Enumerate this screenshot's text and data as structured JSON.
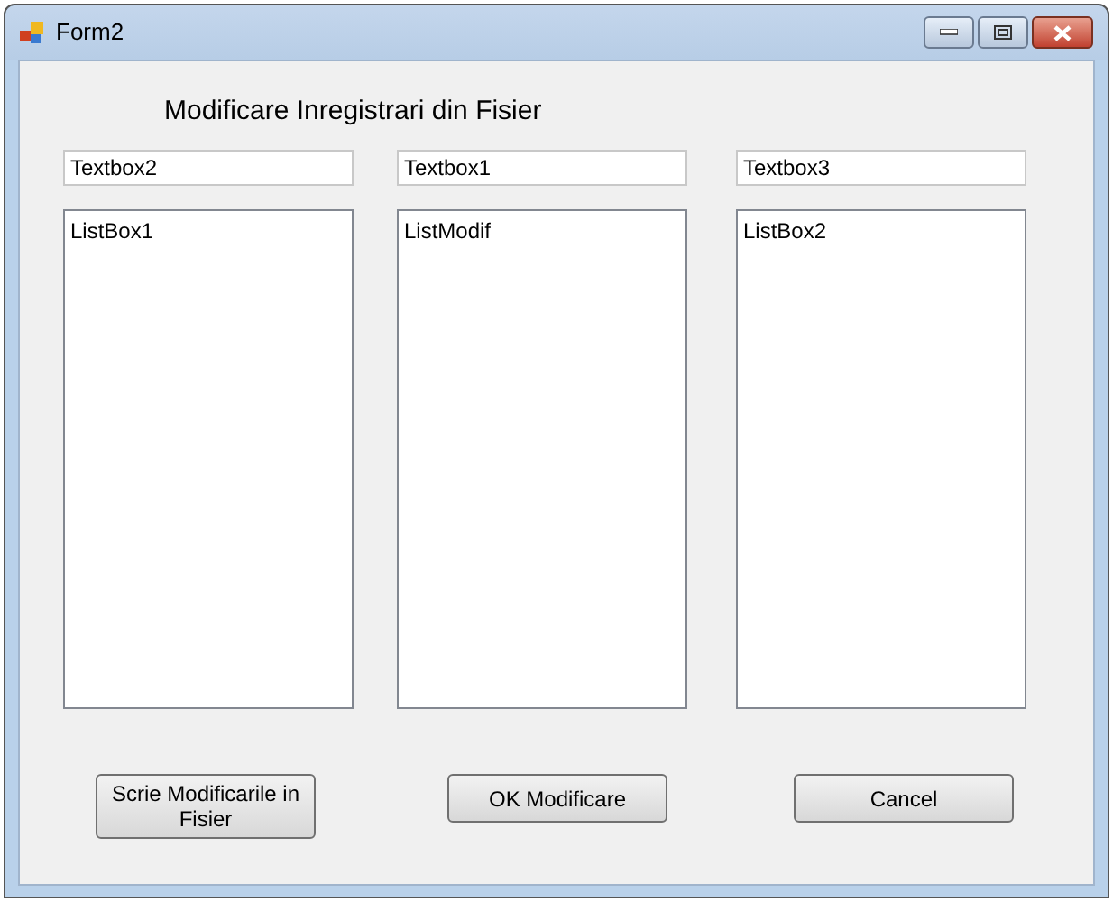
{
  "window": {
    "title": "Form2"
  },
  "heading": "Modificare Inregistrari din Fisier",
  "columns": [
    {
      "textbox": "Textbox2",
      "listbox": "ListBox1"
    },
    {
      "textbox": "Textbox1",
      "listbox": "ListModif"
    },
    {
      "textbox": "Textbox3",
      "listbox": "ListBox2"
    }
  ],
  "buttons": [
    "Scrie Modificarile in Fisier",
    "OK Modificare",
    "Cancel"
  ]
}
